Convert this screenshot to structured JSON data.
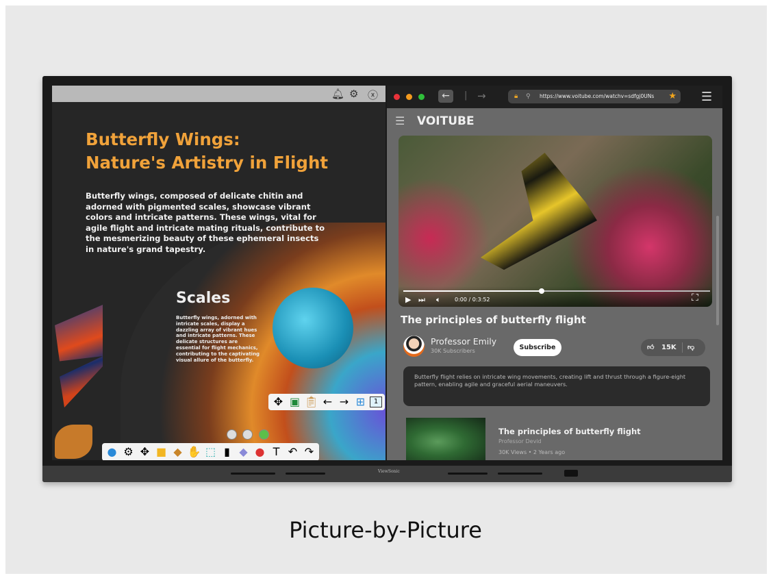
{
  "caption": "Picture-by-Picture",
  "bezel": {
    "brand": "ViewSonic"
  },
  "whiteboard": {
    "top_icons": [
      "bell-icon",
      "gear-icon",
      "close-icon"
    ],
    "title_line1": "Butterfly Wings:",
    "title_line2": "Nature's Artistry in Flight",
    "title_color": "#f0a23a",
    "body": "Butterfly wings, composed of delicate chitin and adorned with pigmented scales, showcase vibrant colors and intricate patterns. These wings, vital for agile flight and intricate mating rituals, contribute to the mesmerizing beauty of these ephemeral insects in nature's grand tapestry.",
    "section_title": "Scales",
    "section_body": "Butterfly wings, adorned with intricate scales, display a dazzling array of vibrant hues and intricate patterns. These delicate structures are essential for flight mechanics, contributing to the captivating visual allure of the butterfly.",
    "page_toolbar": [
      "move",
      "screen-capture",
      "paste",
      "previous-page",
      "next-page",
      "add-page",
      "page-number"
    ],
    "page_number": "1",
    "main_toolbar": [
      "users",
      "settings",
      "move",
      "folder",
      "resources",
      "hand",
      "select",
      "pen",
      "eraser",
      "shapes",
      "text",
      "undo",
      "redo"
    ]
  },
  "browser": {
    "url": "https://www.voitube.com/watchv=sdfgj0UNs",
    "site_name": "VOITUBE",
    "video": {
      "time": "0:00 / 0:3:52",
      "progress_percent": 45
    },
    "title": "The principles of butterfly flight",
    "channel": {
      "name": "Professor Emily",
      "subscribers": "30K Subscribers"
    },
    "subscribe_label": "Subscribe",
    "likes": "15K",
    "description": "Butterfly flight relies on intricate wing movements, creating lift and thrust through a figure-eight pattern, enabling agile and graceful aerial maneuvers.",
    "related": [
      {
        "title": "The principles of butterfly flight",
        "channel": "Professor Devid",
        "meta": "30K Views • 2 Years ago"
      }
    ]
  }
}
